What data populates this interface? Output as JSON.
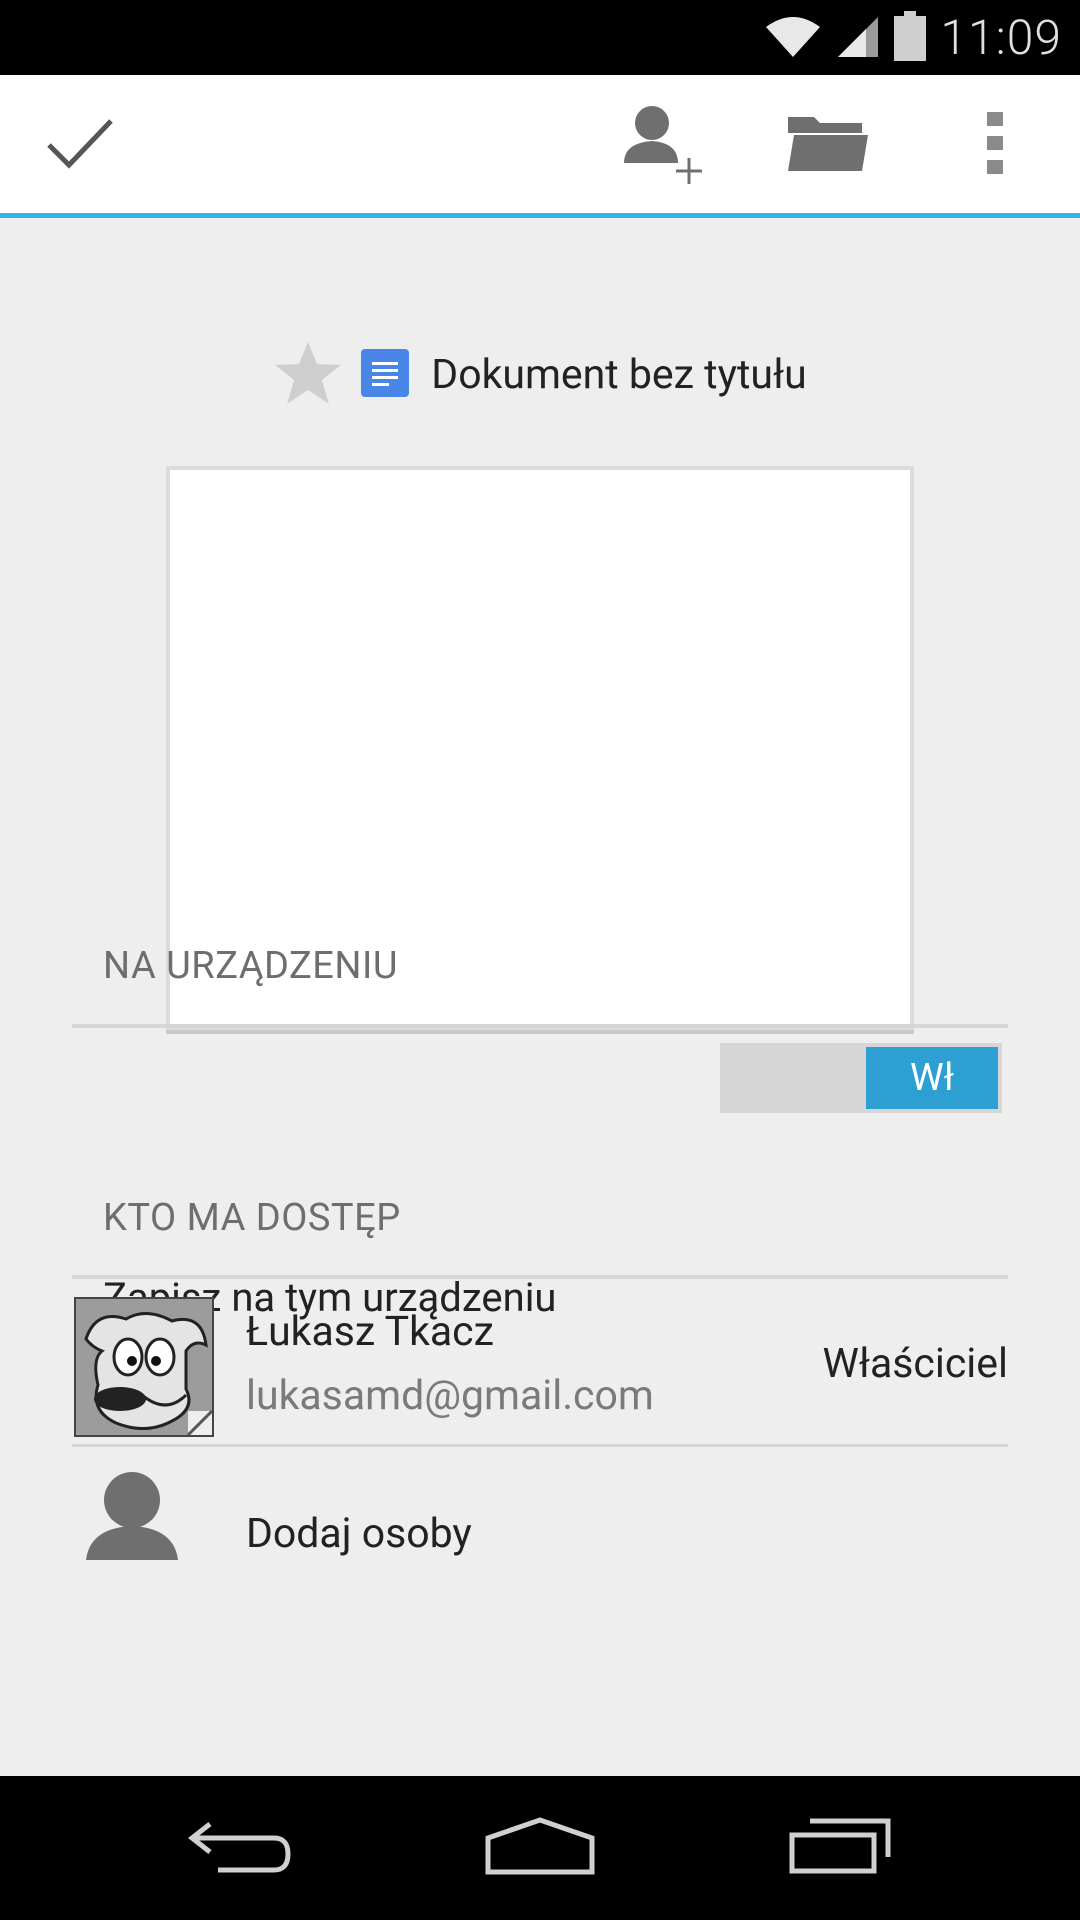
{
  "status_bar": {
    "time": "11:09",
    "icons": [
      "wifi-icon",
      "signal-icon",
      "battery-icon"
    ]
  },
  "action_bar": {
    "done_icon": "check-icon",
    "add_person_icon": "add-person-icon",
    "folder_icon": "folder-icon",
    "overflow_icon": "overflow-menu-icon",
    "accent_color": "#33b5e5"
  },
  "document": {
    "title": "Dokument bez tytułu",
    "starred": false,
    "type_icon": "docs-icon"
  },
  "on_device": {
    "header": "NA URZĄDZENIU",
    "save_label": "Zapisz na tym urządzeniu",
    "toggle_label": "Wł"
  },
  "access": {
    "header": "KTO MA DOSTĘP",
    "people": [
      {
        "name": "Łukasz Tkacz",
        "email": "lukasamd@gmail.com",
        "role": "Właściciel"
      }
    ],
    "add_people_label": "Dodaj osoby"
  },
  "nav_bar": {
    "icons": [
      "back-icon",
      "home-icon",
      "recent-apps-icon"
    ]
  }
}
